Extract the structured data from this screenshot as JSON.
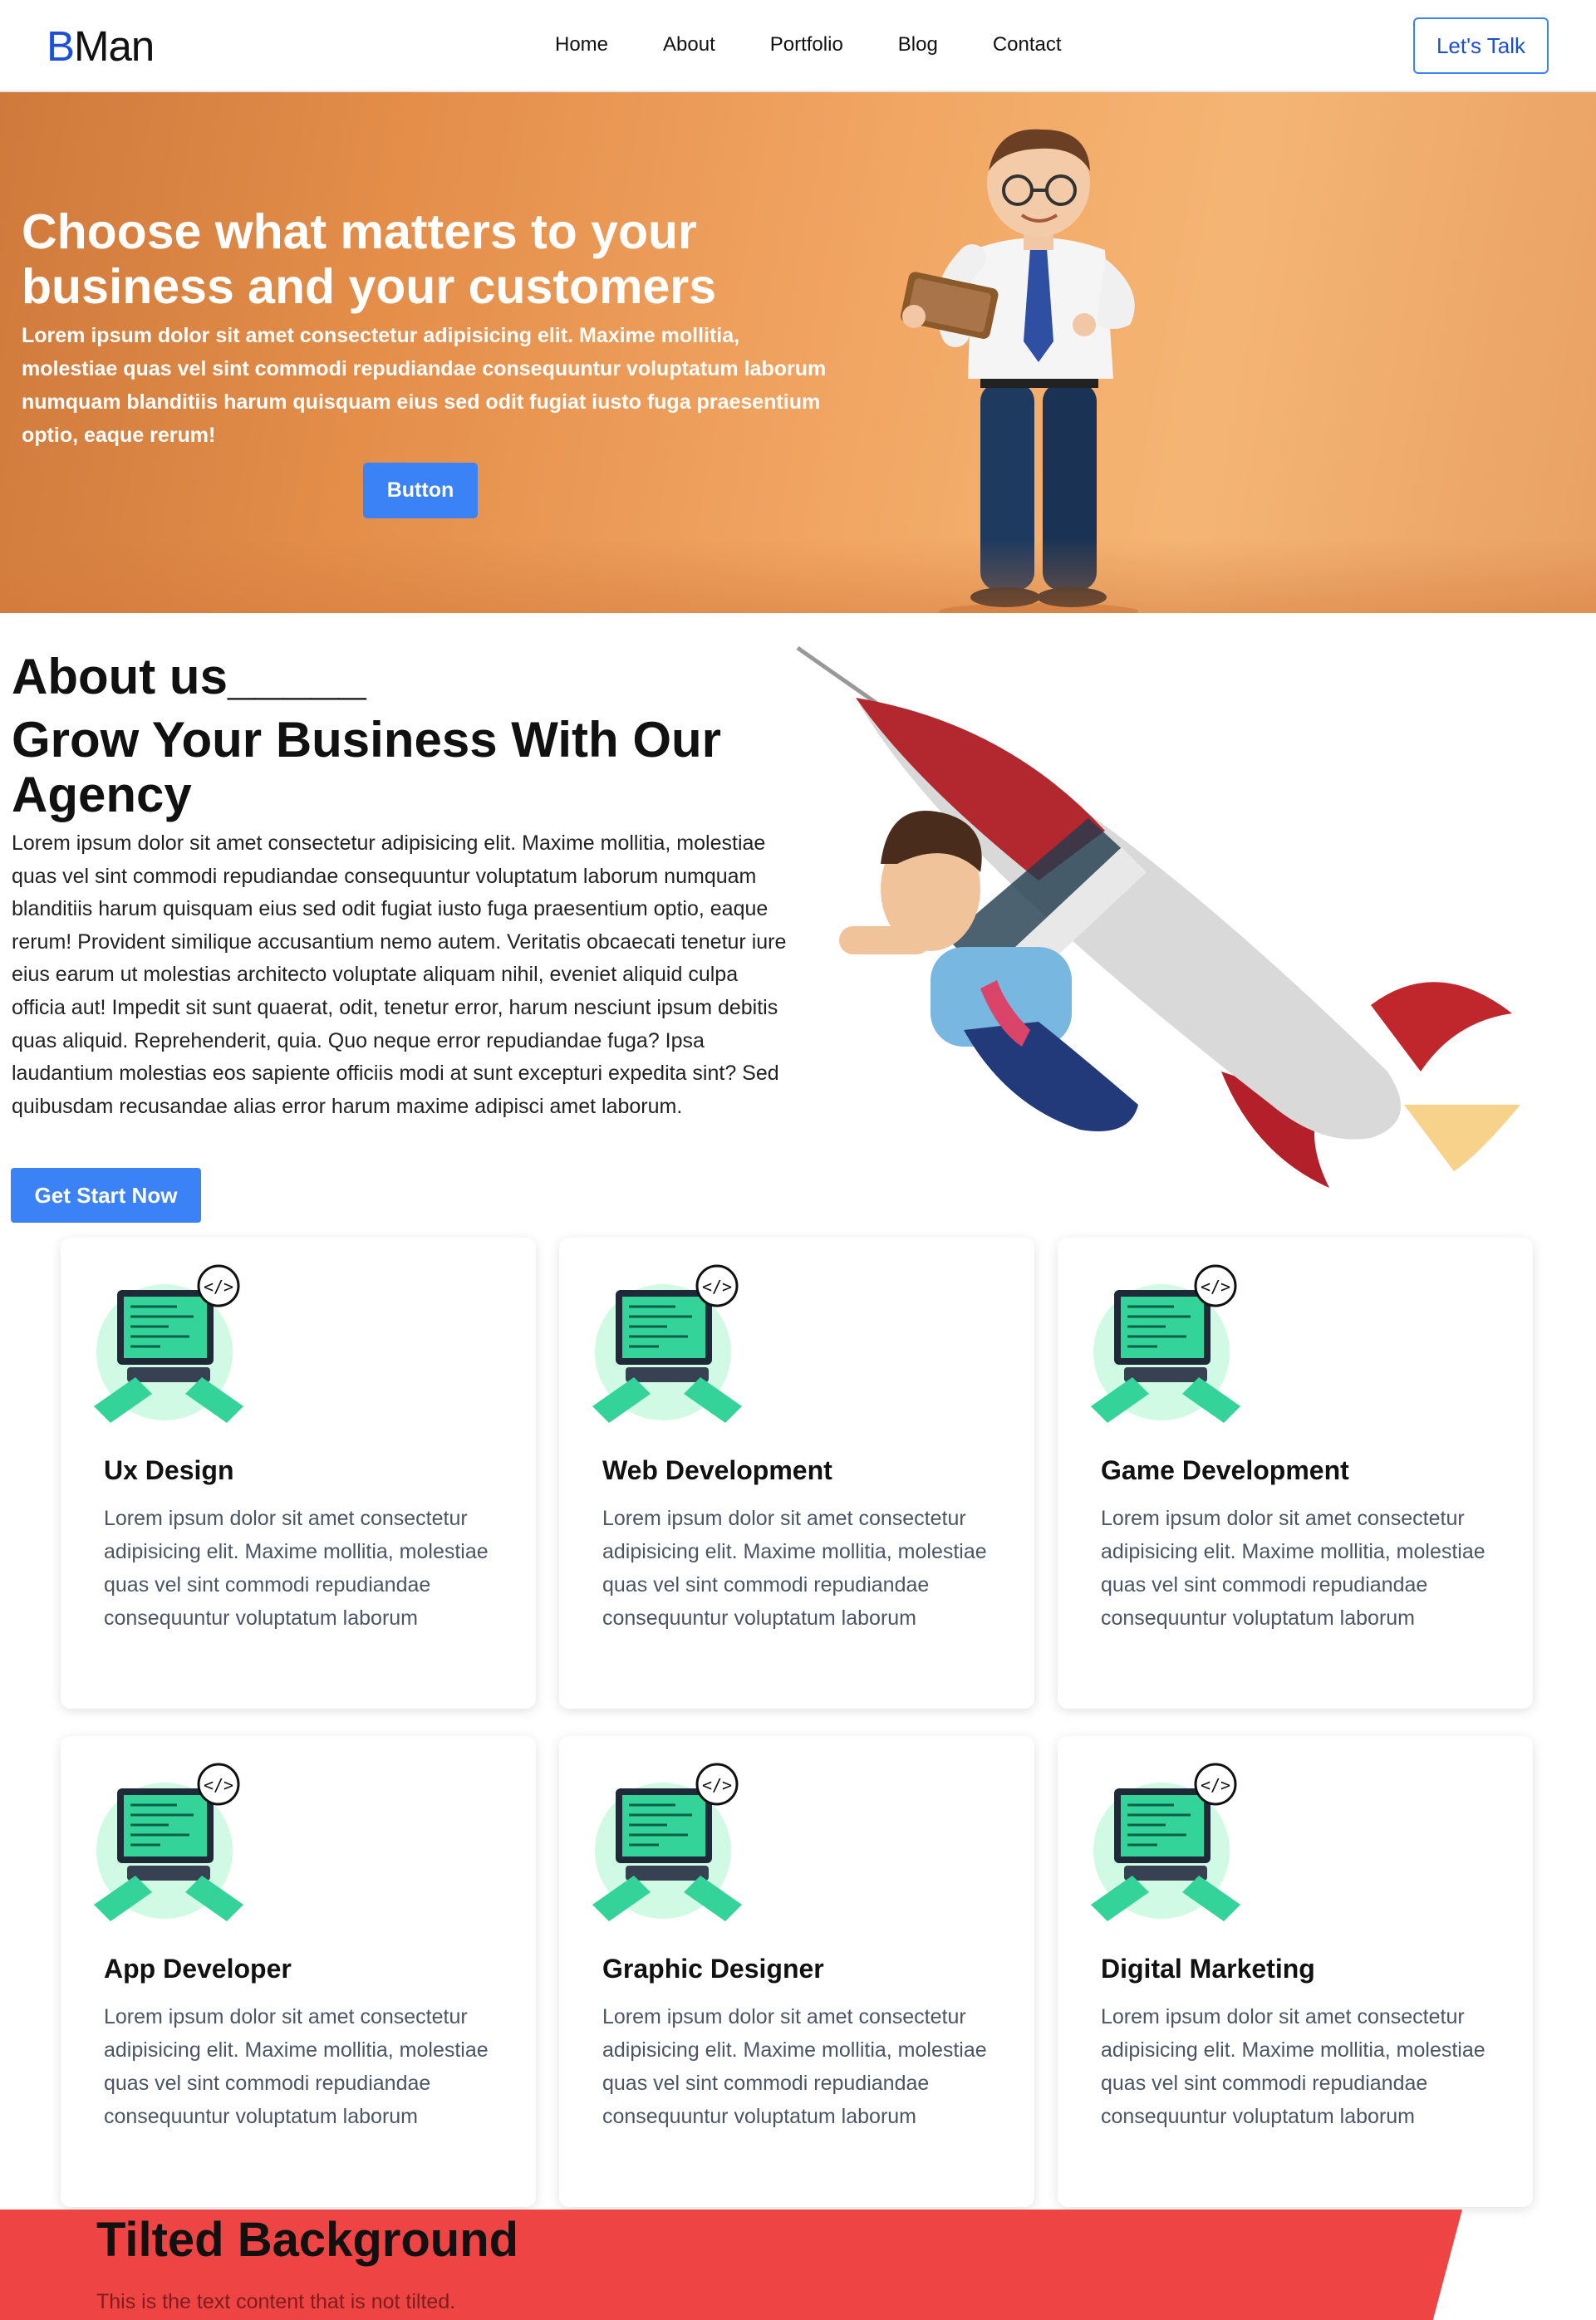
{
  "navbar": {
    "logo_first": "B",
    "logo_rest": "Man",
    "links": [
      "Home",
      "About",
      "Portfolio",
      "Blog",
      "Contact"
    ],
    "cta_label": "Let's Talk"
  },
  "hero": {
    "title": "Choose what matters to your business and your customers",
    "text": "Lorem ipsum dolor sit amet consectetur adipisicing elit. Maxime mollitia, molestiae quas vel sint commodi repudiandae consequuntur voluptatum laborum numquam blanditiis harum quisquam eius sed odit fugiat iusto fuga praesentium optio, eaque rerum!",
    "button_label": "Button"
  },
  "about": {
    "heading": "About us_____",
    "subtitle": "Grow Your Business With Our Agency",
    "text": "Lorem ipsum dolor sit amet consectetur adipisicing elit. Maxime mollitia, molestiae quas vel sint commodi repudiandae consequuntur voluptatum laborum numquam blanditiis harum quisquam eius sed odit fugiat iusto fuga praesentium optio, eaque rerum! Provident similique accusantium nemo autem. Veritatis obcaecati tenetur iure eius earum ut molestias architecto voluptate aliquam nihil, eveniet aliquid culpa officia aut! Impedit sit sunt quaerat, odit, tenetur error, harum nesciunt ipsum debitis quas aliquid. Reprehenderit, quia. Quo neque error repudiandae fuga? Ipsa laudantium molestias eos sapiente officiis modi at sunt excepturi expedita sint? Sed quibusdam recusandae alias error harum maxime adipisci amet laborum.",
    "button_label": "Get Start Now"
  },
  "services": [
    {
      "title": "Ux Design",
      "text": "Lorem ipsum dolor sit amet consectetur adipisicing elit. Maxime mollitia, molestiae quas vel sint commodi repudiandae consequuntur voluptatum laborum"
    },
    {
      "title": "Web Development",
      "text": "Lorem ipsum dolor sit amet consectetur adipisicing elit. Maxime mollitia, molestiae quas vel sint commodi repudiandae consequuntur voluptatum laborum"
    },
    {
      "title": "Game Development",
      "text": "Lorem ipsum dolor sit amet consectetur adipisicing elit. Maxime mollitia, molestiae quas vel sint commodi repudiandae consequuntur voluptatum laborum"
    },
    {
      "title": "App Developer",
      "text": "Lorem ipsum dolor sit amet consectetur adipisicing elit. Maxime mollitia, molestiae quas vel sint commodi repudiandae consequuntur voluptatum laborum"
    },
    {
      "title": "Graphic Designer",
      "text": "Lorem ipsum dolor sit amet consectetur adipisicing elit. Maxime mollitia, molestiae quas vel sint commodi repudiandae consequuntur voluptatum laborum"
    },
    {
      "title": "Digital Marketing",
      "text": "Lorem ipsum dolor sit amet consectetur adipisicing elit. Maxime mollitia, molestiae quas vel sint commodi repudiandae consequuntur voluptatum laborum"
    }
  ],
  "tilted": {
    "title": "Tilted Background",
    "text": "This is the text content that is not tilted."
  },
  "colors": {
    "brand_blue": "#1d4ed8",
    "button_blue": "#3b82f6",
    "hero_orange": "#f2a764",
    "tilted_red": "#ef4444",
    "icon_green": "#34d399"
  },
  "icons": {
    "hero": "businessman-tablet-illustration",
    "about": "man-riding-rocket-illustration",
    "service": "code-laptop-icon"
  }
}
